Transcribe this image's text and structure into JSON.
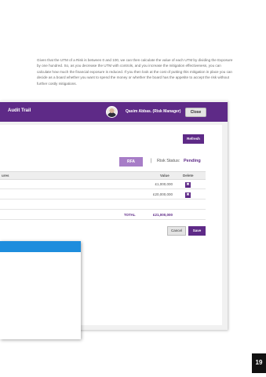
{
  "paragraph": "Given that the UTM of a Risk is between 0 and 100, we can then calculate the value of each UTM by dividing the Exposure by one hundred. So, as you decrease the UTM with controls, and you increase the mitigation effectiveness, you can calculate how much the financial exposure is reduced. If you then look at the cost of putting this mitigation in place you can decide as a board whether you want to spend the money or whether the board has the appetite to accept the risk without further costly mitigations.",
  "screenshot": {
    "window_title": "Audit Trail",
    "user": "Qasim Abbas. (Risk Manager)",
    "close_label": "Close",
    "refresh_label": "Refresh",
    "rfa_label": "RFA",
    "separator": "|",
    "status_label": "Risk Status:",
    "status_value": "Pending",
    "table": {
      "col_header_partial": "ures",
      "col_value": "Value",
      "col_delete": "Delete",
      "rows": [
        {
          "value": "£1,000,000",
          "delete_glyph": "✖"
        },
        {
          "value": "£20,000,000",
          "delete_glyph": "✖"
        }
      ],
      "total_label": "TOTAL",
      "total_value": "£21,000,000"
    },
    "cancel_label": "Cancel",
    "save_label": "Save"
  },
  "page_number": "19",
  "colors": {
    "brand_purple": "#5e2a87",
    "rfa_purple": "#a77dc7",
    "dialog_blue": "#1e8ddd"
  }
}
